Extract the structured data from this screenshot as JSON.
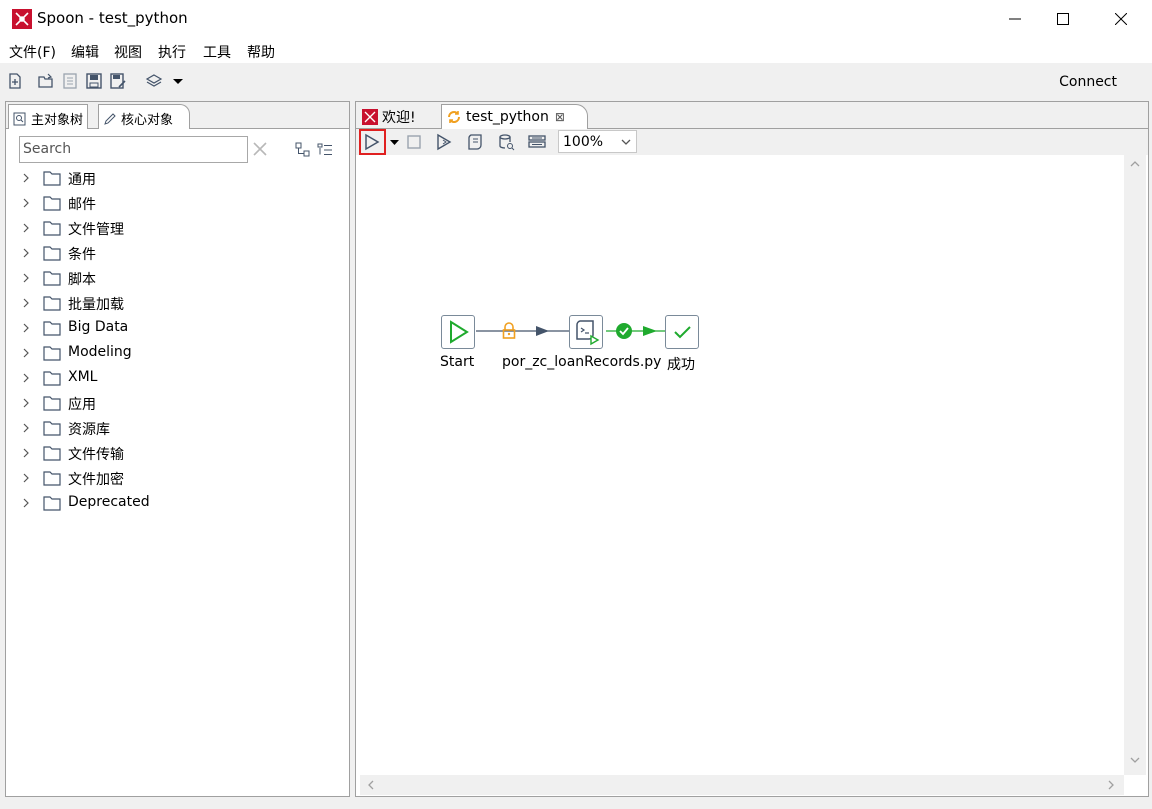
{
  "window": {
    "title": "Spoon - test_python"
  },
  "menu": {
    "items": [
      "文件(F)",
      "编辑",
      "视图",
      "执行",
      "工具",
      "帮助"
    ]
  },
  "toolbar": {
    "connect_label": "Connect"
  },
  "left_panel": {
    "tabs": [
      {
        "label": "主对象树",
        "icon": "tree-icon"
      },
      {
        "label": "核心对象",
        "icon": "pencil-icon"
      }
    ],
    "search_placeholder": "Search",
    "tree_items": [
      "通用",
      "邮件",
      "文件管理",
      "条件",
      "脚本",
      "批量加载",
      "Big Data",
      "Modeling",
      "XML",
      "应用",
      "资源库",
      "文件传输",
      "文件加密",
      "Deprecated"
    ]
  },
  "right_panel": {
    "tabs": [
      {
        "label": "欢迎!",
        "icon": "spoon-icon"
      },
      {
        "label": "test_python",
        "icon": "job-icon",
        "close": "⊠"
      }
    ],
    "zoom": "100%"
  },
  "job": {
    "nodes": [
      {
        "label": "Start",
        "icon": "start-icon"
      },
      {
        "label": "por_zc_loanRecords.py",
        "icon": "shell-script-icon"
      },
      {
        "label": "成功",
        "icon": "success-icon"
      }
    ],
    "hops": [
      {
        "type": "unconditional",
        "icon": "lock-icon",
        "color": "#f0a020"
      },
      {
        "type": "on-success",
        "icon": "check-circle-icon",
        "color": "#1faa2e"
      }
    ]
  },
  "colors": {
    "highlight_box": "#e02020",
    "brand_red": "#c8102e"
  }
}
